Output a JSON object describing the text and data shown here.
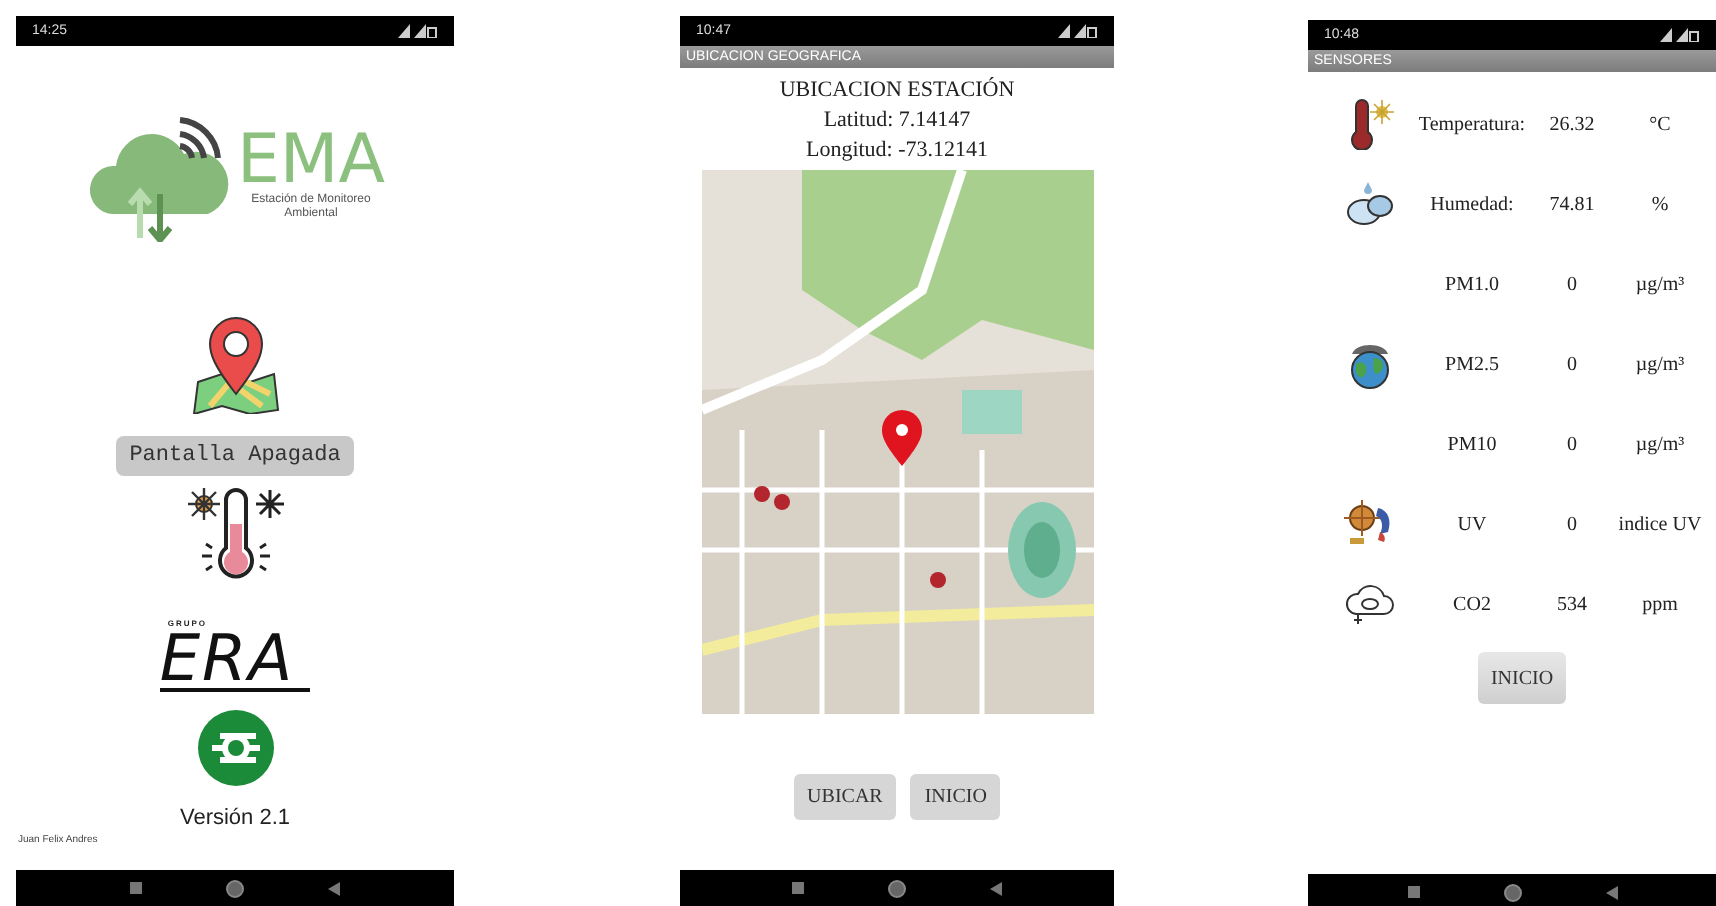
{
  "screens": [
    {
      "kind": "home",
      "status_time": "14:25",
      "logo": {
        "title": "EMA",
        "subtitle": "Estación de Monitoreo Ambiental"
      },
      "button": "Pantalla Apagada",
      "brand": {
        "caption": "GRUPO",
        "name": "ERA"
      },
      "version": "Versión 2.1",
      "credits": "Juan Felix Andres"
    },
    {
      "kind": "map",
      "status_time": "10:47",
      "title_bar": "UBICACION GEOGRAFICA",
      "heading": "UBICACION ESTACIÓN",
      "latitude": "Latitud: 7.14147",
      "longitude": "Longitud: -73.12141",
      "buttons": [
        "UBICAR",
        "INICIO"
      ]
    },
    {
      "kind": "sensors",
      "status_time": "10:48",
      "title_bar": "SENSORES",
      "rows": [
        {
          "kind": "thermometer",
          "label": "Temperatura:",
          "value": "26.32",
          "unit": "°C"
        },
        {
          "kind": "humidity",
          "label": "Humedad:",
          "value": "74.81",
          "unit": "%"
        },
        {
          "label": "PM1.0",
          "value": "0",
          "unit": "µg/m³"
        },
        {
          "kind": "earth",
          "label": "PM2.5",
          "value": "0",
          "unit": "µg/m³"
        },
        {
          "label": "PM10",
          "value": "0",
          "unit": "µg/m³"
        },
        {
          "kind": "uv",
          "label": "UV",
          "value": "0",
          "unit": "indice UV"
        },
        {
          "kind": "co2",
          "label": "CO2",
          "value": "534",
          "unit": "ppm"
        }
      ],
      "button": "INICIO"
    }
  ]
}
